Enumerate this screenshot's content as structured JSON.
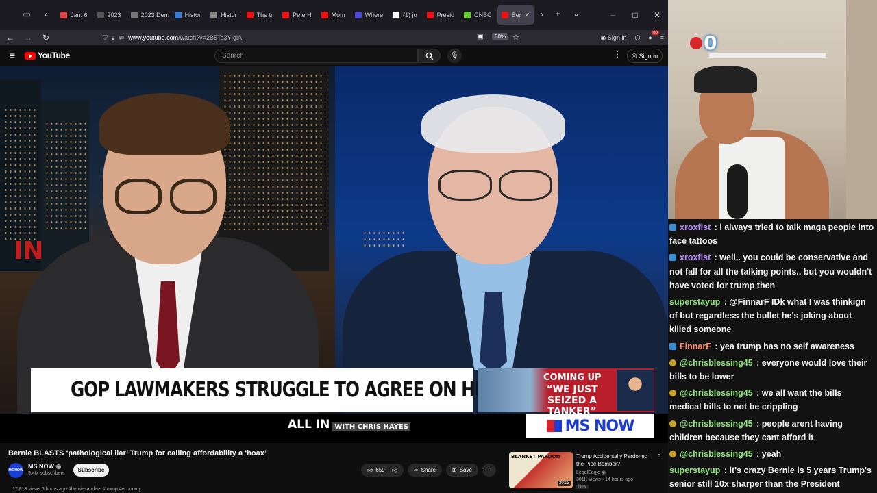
{
  "browser": {
    "tabs": [
      {
        "label": "Jan. 6",
        "color": "#d44"
      },
      {
        "label": "2023",
        "color": "#555"
      },
      {
        "label": "2023 Dem",
        "color": "#777"
      },
      {
        "label": "Histor",
        "color": "#3a7bd5"
      },
      {
        "label": "Histor",
        "color": "#888"
      },
      {
        "label": "The tr",
        "color": "#e11"
      },
      {
        "label": "Pete H",
        "color": "#e11"
      },
      {
        "label": "Mom",
        "color": "#e11"
      },
      {
        "label": "Where",
        "color": "#4a4ad6"
      },
      {
        "label": "(1) jo",
        "color": "#fff"
      },
      {
        "label": "Presid",
        "color": "#e11"
      },
      {
        "label": "CNBC",
        "color": "#6c3"
      },
      {
        "label": "Ber",
        "color": "#e11",
        "active": true
      }
    ],
    "url_host": "www.youtube.com",
    "url_path": "/watch?v=2B5Ta3YIgiA",
    "zoom": "80%",
    "sign_in": "Sign in",
    "notif_count": "60"
  },
  "youtube": {
    "logo": "YouTube",
    "search_placeholder": "Search",
    "sign_in": "Sign in",
    "player": {
      "in_bug": "IN",
      "headline": "GOP LAWMAKERS STRUGGLE TO AGREE ON HEALTH CARE PLAN",
      "coming_up": "COMING UP",
      "coming_quote": "“WE JUST SEIZED A TANKER”",
      "show_all_in": "ALL IN",
      "show_with": "WITH CHRIS HAYES",
      "network": "MS NOW"
    },
    "video_title": "Bernie BLASTS ‘pathological liar’ Trump for calling affordability a ‘hoax’",
    "channel": {
      "name": "MS NOW",
      "avatar": "MS NOW",
      "subs": "9.4M subscribers",
      "subscribe": "Subscribe"
    },
    "actions": {
      "likes": "659",
      "share": "Share",
      "save": "Save"
    },
    "views_line": "17,813 views  6 hours ago  #berniesanders #trump #economy",
    "recommendation": {
      "title": "Trump Accidentally Pardoned the Pipe Bomber?",
      "channel": "LegalEagle",
      "meta": "301K views • 14 hours ago",
      "badge": "New",
      "duration": "20:03",
      "thumb_text": "BLANKET PARDON"
    }
  },
  "stream": {
    "counter": "0",
    "chat": [
      {
        "user": "xroxfist",
        "badge": "blue",
        "color": "#b88cff",
        "text": "i always tried to talk maga people into face tattoos"
      },
      {
        "user": "xroxfist",
        "badge": "blue",
        "color": "#b88cff",
        "text": "well.. you could be conservative and not fall for all the talking points.. but you wouldn't have voted for trump then"
      },
      {
        "user": "superstayup",
        "badge": "",
        "color": "#8fe27a",
        "text": "@FinnarF IDk what I was thinkign of but regardless the bullet he's joking about killed someone"
      },
      {
        "user": "FinnarF",
        "badge": "blue",
        "color": "#ff8a6a",
        "text": "yea trump has no self awareness"
      },
      {
        "user": "@chrisblessing45",
        "badge": "gold",
        "color": "#8fe27a",
        "text": "everyone would love their bills to be lower"
      },
      {
        "user": "@chrisblessing45",
        "badge": "gold",
        "color": "#8fe27a",
        "text": "we all want the bills medical bills to not be crippling"
      },
      {
        "user": "@chrisblessing45",
        "badge": "gold",
        "color": "#8fe27a",
        "text": "people arent having children because they cant afford it"
      },
      {
        "user": "@chrisblessing45",
        "badge": "gold",
        "color": "#8fe27a",
        "text": "yeah"
      },
      {
        "user": "superstayup",
        "badge": "",
        "color": "#8fe27a",
        "text": "it's crazy Bernie is 5 years Trump's senior still 10x sharper than the President"
      }
    ]
  }
}
